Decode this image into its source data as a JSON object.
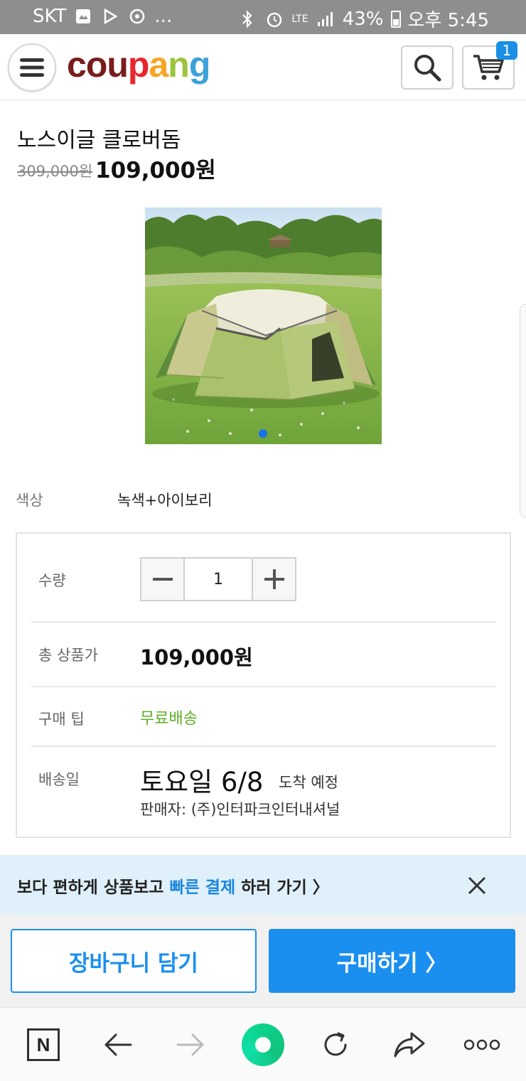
{
  "status_bar": {
    "carrier": "SKT",
    "more": "...",
    "network": "LTE",
    "battery": "43%",
    "time": "오후 5:45"
  },
  "header": {
    "logo_letters": [
      {
        "char": "c",
        "color": "#7a1c1c"
      },
      {
        "char": "o",
        "color": "#7a1c1c"
      },
      {
        "char": "u",
        "color": "#7a1c1c"
      },
      {
        "char": "p",
        "color": "#e8262c"
      },
      {
        "char": "a",
        "color": "#f5a623"
      },
      {
        "char": "n",
        "color": "#9bc43c"
      },
      {
        "char": "g",
        "color": "#3ca2d9"
      }
    ],
    "cart_count": "1"
  },
  "product": {
    "title": "노스이글 클로버돔",
    "original_price": "309,000원",
    "sale_price": "109,000원"
  },
  "option": {
    "label": "색상",
    "value": "녹색+아이보리"
  },
  "details": {
    "quantity_label": "수량",
    "quantity_value": "1",
    "total_label": "총 상품가",
    "total_price": "109,000원",
    "tip_label": "구매 팁",
    "tip_value": "무료배송",
    "delivery_label": "배송일",
    "delivery_date": "토요일 6/8",
    "delivery_suffix": "도착 예정",
    "seller": "판매자: (주)인터파크인터내셔널"
  },
  "banner": {
    "text_prefix": "보다 편하게 상품보고 ",
    "text_highlight": "빠른 결제",
    "text_suffix": " 하러 가기 〉"
  },
  "actions": {
    "cart_label": "장바구니 담기",
    "buy_label": "구매하기 〉"
  },
  "browser_nav": {
    "n_label": "N"
  },
  "colors": {
    "accent": "#1a8ff0",
    "free_shipping": "#5cb026",
    "banner_bg": "#dff0fb"
  }
}
